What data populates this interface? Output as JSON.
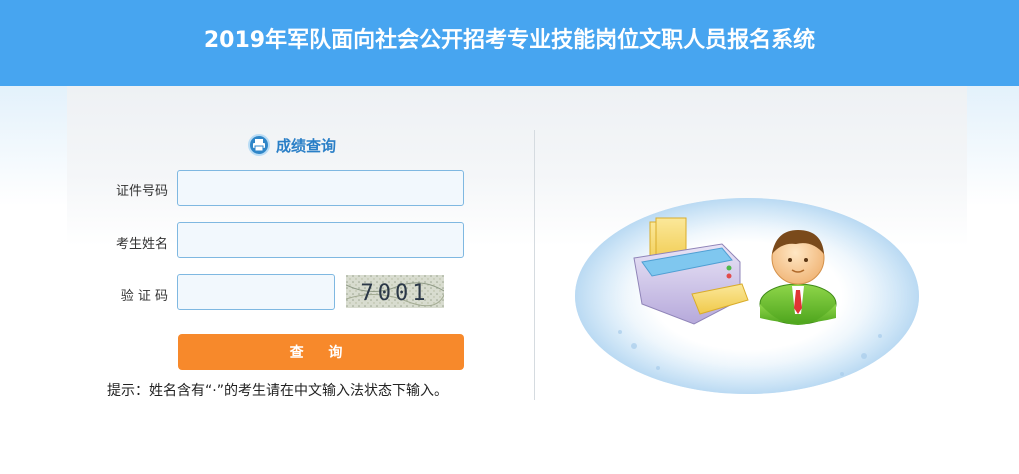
{
  "header": {
    "title": "2019年军队面向社会公开招考专业技能岗位文职人员报名系统"
  },
  "form": {
    "section_title": "成绩查询",
    "id_label": "证件号码",
    "id_value": "",
    "name_label": "考生姓名",
    "name_value": "",
    "captcha_label": "验 证 码",
    "captcha_value": "",
    "captcha_image_text": "7001",
    "submit_label": "查 询",
    "hint": "提示：姓名含有“·”的考生请在中文输入法状态下输入。"
  },
  "colors": {
    "header_bg": "#47a5f0",
    "accent": "#2a7fc7",
    "button": "#f7892b",
    "field_border": "#7fb8e1"
  },
  "icons": {
    "section": "printer-icon",
    "illustration": "printer-person-illustration"
  }
}
